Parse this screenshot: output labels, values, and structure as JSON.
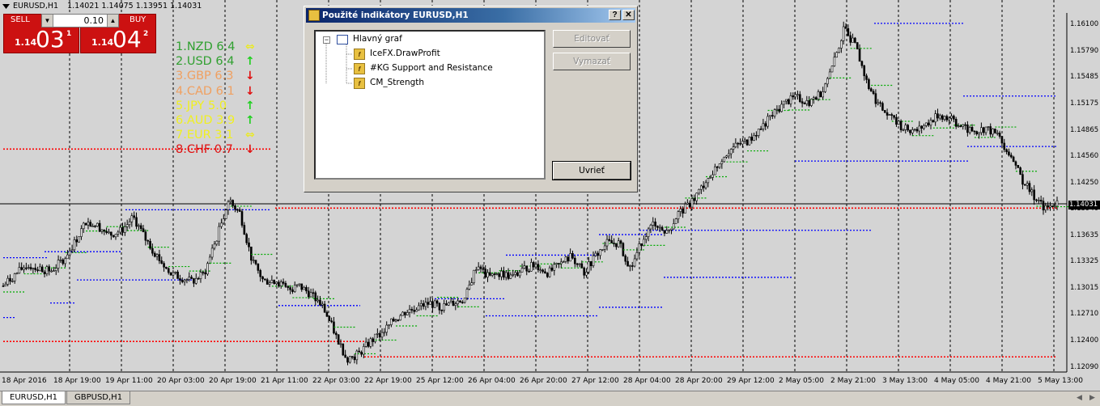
{
  "header": {
    "symbol": "EURUSD,H1",
    "ohlc": "1.14021 1.14075 1.13951 1.14031"
  },
  "trade_panel": {
    "sell_label": "SELL",
    "buy_label": "BUY",
    "lot_value": "0.10",
    "sell_small": "1.14",
    "sell_big": "03",
    "sell_sup": "1",
    "buy_small": "1.14",
    "buy_big": "04",
    "buy_sup": "2",
    "sell_color": "#cc1111",
    "buy_color": "#cc1111"
  },
  "strength": [
    {
      "text": "1.NZD  6.4",
      "color": "#30a030",
      "arrow": "⇔",
      "arrow_color": "#e8e830"
    },
    {
      "text": "2.USD  6.4",
      "color": "#30a030",
      "arrow": "↑",
      "arrow_color": "#20d020"
    },
    {
      "text": "3.GBP  6.3",
      "color": "#f0a060",
      "arrow": "↓",
      "arrow_color": "#e01010"
    },
    {
      "text": "4.CAD  6.1",
      "color": "#f0a060",
      "arrow": "↓",
      "arrow_color": "#e01010"
    },
    {
      "text": "5.JPY  5.0",
      "color": "#f0f020",
      "arrow": "↑",
      "arrow_color": "#20d020"
    },
    {
      "text": "6.AUD  3.9",
      "color": "#f0f020",
      "arrow": "↑",
      "arrow_color": "#20d020"
    },
    {
      "text": "7.EUR  3.1",
      "color": "#f0f020",
      "arrow": "⇔",
      "arrow_color": "#e8e830"
    },
    {
      "text": "8.CHF  0.7",
      "color": "#e01010",
      "arrow": "↓",
      "arrow_color": "#e01010"
    }
  ],
  "price_axis": [
    {
      "label": "1.16100",
      "price": 1.161
    },
    {
      "label": "1.15790",
      "price": 1.1579
    },
    {
      "label": "1.15485",
      "price": 1.15485
    },
    {
      "label": "1.15175",
      "price": 1.15175
    },
    {
      "label": "1.14865",
      "price": 1.14865
    },
    {
      "label": "1.14560",
      "price": 1.1456
    },
    {
      "label": "1.14250",
      "price": 1.1425
    },
    {
      "label": "1.13940",
      "price": 1.1394
    },
    {
      "label": "1.13635",
      "price": 1.13635
    },
    {
      "label": "1.13325",
      "price": 1.13325
    },
    {
      "label": "1.13015",
      "price": 1.13015
    },
    {
      "label": "1.12710",
      "price": 1.1271
    },
    {
      "label": "1.12400",
      "price": 1.124
    },
    {
      "label": "1.12090",
      "price": 1.1209
    }
  ],
  "current_price": "1.14031",
  "time_axis": [
    "18 Apr 2016",
    "18 Apr 19:00",
    "19 Apr 11:00",
    "20 Apr 03:00",
    "20 Apr 19:00",
    "21 Apr 11:00",
    "22 Apr 03:00",
    "22 Apr 19:00",
    "25 Apr 12:00",
    "26 Apr 04:00",
    "26 Apr 20:00",
    "27 Apr 12:00",
    "28 Apr 04:00",
    "28 Apr 20:00",
    "29 Apr 12:00",
    "2 May 05:00",
    "2 May 21:00",
    "3 May 13:00",
    "4 May 05:00",
    "4 May 21:00",
    "5 May 13:00"
  ],
  "dialog": {
    "title": "Použité indikátory EURUSD,H1",
    "help_label": "?",
    "close_label": "✕",
    "tree_root": "Hlavný graf",
    "indicators": [
      "IceFX.DrawProfit",
      "#KG Support and Resistance",
      "CM_Strength"
    ],
    "edit_label": "Editovať",
    "delete_label": "Vymazať",
    "release_label": "Uvrieť"
  },
  "tabs": [
    {
      "label": "EURUSD,H1",
      "active": true
    },
    {
      "label": "GBPUSD,H1",
      "active": false
    }
  ],
  "colors": {
    "chart_bg": "#d4d4d4",
    "grid": "#000000",
    "candle": "#000000",
    "support": "#0000ff",
    "resistance_red": "#ff0000",
    "minor_green": "#00aa00"
  },
  "chart_data": {
    "type": "candlestick",
    "symbol": "EURUSD",
    "timeframe": "H1",
    "ylim": [
      1.1209,
      1.161
    ],
    "close_path_approx": [
      1.1305,
      1.1318,
      1.133,
      1.1325,
      1.1322,
      1.1335,
      1.1355,
      1.138,
      1.1375,
      1.1365,
      1.137,
      1.1385,
      1.136,
      1.134,
      1.132,
      1.1315,
      1.131,
      1.132,
      1.136,
      1.1405,
      1.139,
      1.1335,
      1.131,
      1.1312,
      1.13,
      1.1305,
      1.1295,
      1.128,
      1.125,
      1.122,
      1.1225,
      1.124,
      1.125,
      1.1265,
      1.1275,
      1.128,
      1.1285,
      1.128,
      1.1285,
      1.129,
      1.133,
      1.1315,
      1.132,
      1.1315,
      1.1325,
      1.133,
      1.132,
      1.133,
      1.134,
      1.132,
      1.134,
      1.1355,
      1.1355,
      1.1325,
      1.136,
      1.138,
      1.1365,
      1.139,
      1.14,
      1.142,
      1.144,
      1.146,
      1.147,
      1.1475,
      1.149,
      1.1505,
      1.152,
      1.1525,
      1.152,
      1.153,
      1.156,
      1.1605,
      1.1585,
      1.154,
      1.1515,
      1.15,
      1.149,
      1.1485,
      1.1495,
      1.1505,
      1.15,
      1.149,
      1.1485,
      1.149,
      1.148,
      1.146,
      1.143,
      1.141,
      1.1395,
      1.1403
    ]
  }
}
